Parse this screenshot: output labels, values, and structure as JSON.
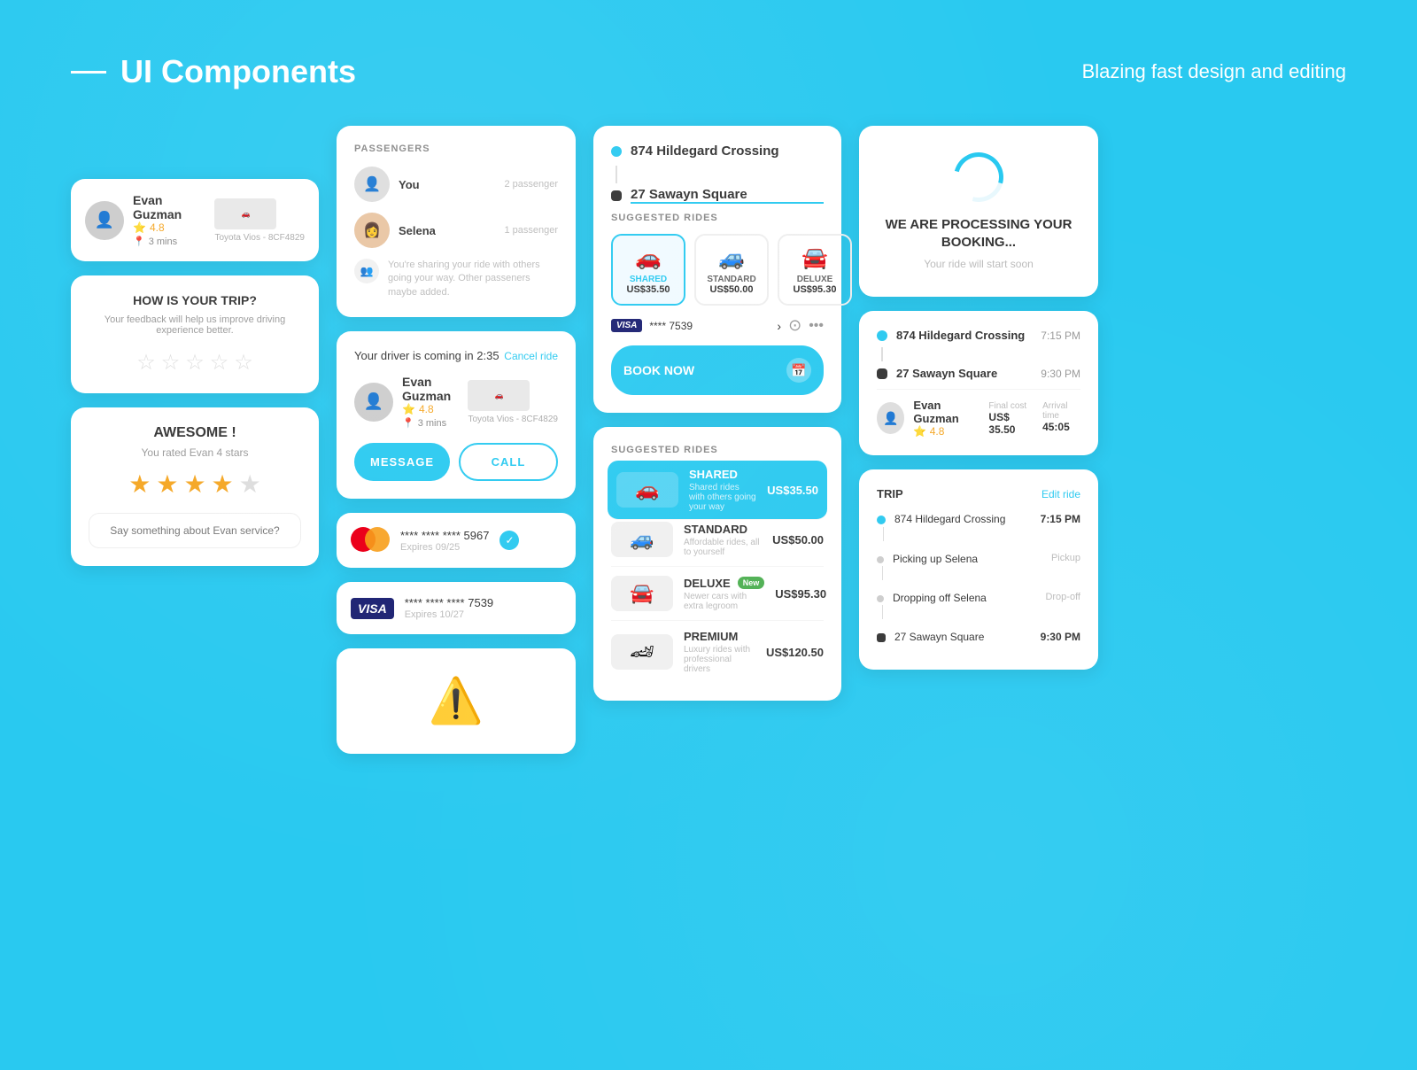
{
  "header": {
    "title": "UI Components",
    "subtitle": "Blazing fast design and editing",
    "line": "—"
  },
  "col1": {
    "driver_card": {
      "name": "Evan Guzman",
      "rating": "4.8",
      "time": "3 mins",
      "car": "Toyota Vios - 8CF4829"
    },
    "trip_card": {
      "title": "HOW IS YOUR TRIP?",
      "subtitle": "Your feedback will help us improve driving experience better."
    },
    "awesome_card": {
      "title": "AWESOME !",
      "subtitle": "You rated Evan  4 stars",
      "placeholder": "Say something about Evan service?"
    }
  },
  "col2": {
    "passengers_card": {
      "label": "PASSENGERS",
      "passengers": [
        {
          "name": "You",
          "count": "2 passenger"
        },
        {
          "name": "Selena",
          "count": "1 passenger"
        }
      ],
      "share_note": "You're sharing your ride with others going your way. Other passeners maybe added."
    },
    "driver_coming": {
      "text": "Your driver is coming in 2:35",
      "cancel": "Cancel ride",
      "driver_name": "Evan Guzman",
      "driver_rating": "4.8",
      "driver_time": "3 mins",
      "driver_car": "Toyota Vios - 8CF4829",
      "message_btn": "MESSAGE",
      "call_btn": "CALL"
    },
    "mastercard": {
      "number": "**** **** **** 5967",
      "expiry": "Expires 09/25"
    },
    "visa": {
      "number": "**** **** **** 7539",
      "expiry": "Expires 10/27",
      "logo": "VISA"
    },
    "alert": "⚠"
  },
  "col3": {
    "route": {
      "from": "874 Hildegard Crossing",
      "to": "27 Sawayn Square"
    },
    "suggested_label": "SUGGESTED RIDES",
    "rides": [
      {
        "type": "SHARED",
        "price": "US$35.50",
        "selected": true
      },
      {
        "type": "STANDARD",
        "price": "US$50.00"
      },
      {
        "type": "DELUXE",
        "price": "US$95.30"
      }
    ],
    "payment": {
      "card_dots": "**** 7539",
      "logo": "VISA"
    },
    "book_btn": "BOOK NOW",
    "suggested_rides_lower": {
      "label": "SUGGESTED RIDES",
      "rides": [
        {
          "name": "SHARED",
          "desc": "Shared rides with others going your way",
          "price": "US$35.50",
          "selected": true
        },
        {
          "name": "STANDARD",
          "desc": "Affordable rides, all to yourself",
          "price": "US$50.00"
        },
        {
          "name": "DELUXE",
          "desc": "Newer cars with extra legroom",
          "price": "US$95.30",
          "new": true
        },
        {
          "name": "PREMIUM",
          "desc": "Luxury rides with professional drivers",
          "price": "US$120.50"
        }
      ]
    }
  },
  "col4": {
    "processing": {
      "title": "WE ARE PROCESSING YOUR BOOKING...",
      "subtitle": "Your ride will start soon"
    },
    "route_summary": {
      "from": "874 Hildegard Crossing",
      "from_time": "7:15 PM",
      "to": "27 Sawayn Square",
      "to_time": "9:30 PM",
      "driver_name": "Evan Guzman",
      "driver_rating": "4.8",
      "final_cost_label": "Final cost",
      "final_cost": "US$ 35.50",
      "arrival_label": "Arrival time",
      "arrival_time": "45:05"
    },
    "trip": {
      "title": "TRIP",
      "edit": "Edit ride",
      "stops": [
        {
          "name": "874 Hildegard Crossing",
          "action": "",
          "time": "7:15 PM",
          "type": "blue"
        },
        {
          "name": "Picking up Selena",
          "action": "Pickup",
          "time": "",
          "type": "gray"
        },
        {
          "name": "Dropping off Selena",
          "action": "Drop-off",
          "time": "",
          "type": "gray"
        },
        {
          "name": "27 Sawayn Square",
          "action": "",
          "time": "9:30 PM",
          "type": "black"
        }
      ]
    }
  }
}
